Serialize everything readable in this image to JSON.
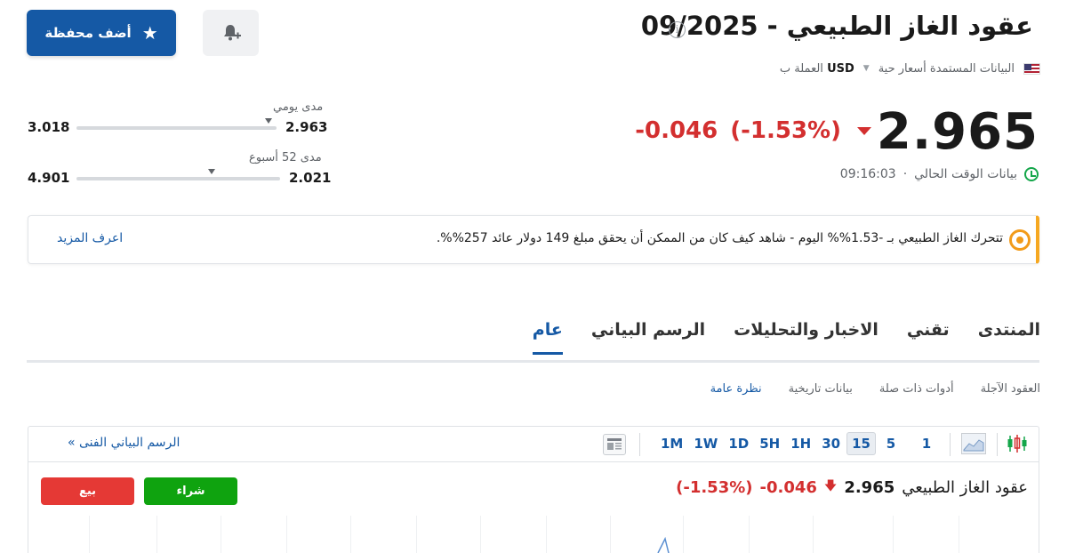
{
  "header": {
    "title": "عقود الغاز الطبيعي - 09/2025",
    "info_icon": "info-icon",
    "data_source": "البيانات المستمدة أسعار حية",
    "currency_label": "العملة ب",
    "currency": "USD",
    "add_portfolio_label": "أضف محفظة",
    "alert_icon": "bell-plus-icon"
  },
  "quote": {
    "last": "2.965",
    "change": "-0.046",
    "change_pct": "(-1.53%)",
    "time_label": "بيانات الوقت الحالي",
    "time": "09:16:03",
    "status_color": "#14a64a",
    "down_color": "#d32f2f"
  },
  "ranges": {
    "daily": {
      "label": "مدى يومي",
      "low": "2.963",
      "high": "3.018",
      "position": 0.04
    },
    "week52": {
      "label": "مدى 52 أسبوع",
      "low": "2.021",
      "high": "4.901",
      "position": 0.33
    }
  },
  "banner": {
    "text": "تتحرك الغاز الطبيعي بـ -1.53%% اليوم - شاهد كيف كان من الممكن أن يحقق مبلغ 149 دولار عائد 257%%.",
    "learn_more": "اعرف المزيد"
  },
  "tabs": [
    "عام",
    "الرسم البياني",
    "الاخبار والتحليلات",
    "تقني",
    "المنتدى"
  ],
  "subnav": [
    "نظرة عامة",
    "بيانات تاريخية",
    "أدوات ذات صلة",
    "العقود الآجلة"
  ],
  "chart": {
    "timeframes": [
      "1M",
      "1W",
      "1D",
      "5H",
      "1H",
      "30",
      "15",
      "5",
      "1"
    ],
    "active_timeframe": "15",
    "tech_chart_link": "الرسم البياني الفنى »",
    "quote_name": "عقود الغاز الطبيعي",
    "quote_price": "2.965",
    "quote_change": "-0.046",
    "quote_change_pct": "(-1.53%)",
    "buy_label": "شراء",
    "sell_label": "بيع",
    "buy_color": "#0fa30f",
    "sell_color": "#e53935"
  }
}
